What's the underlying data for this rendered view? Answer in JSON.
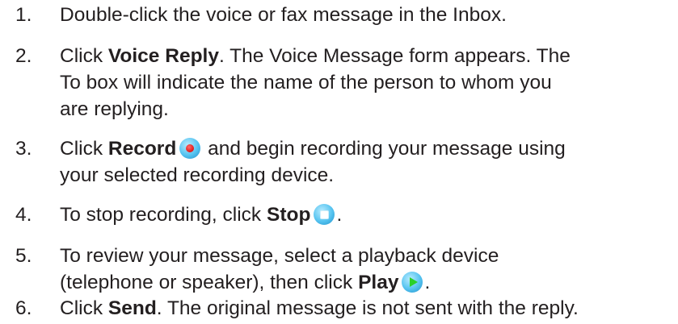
{
  "steps": [
    {
      "number": "1.",
      "line1": "Double-click the voice or fax message in the Inbox."
    },
    {
      "number": "2.",
      "pre": "Click ",
      "bold": "Voice Reply",
      "line1_post": ". The Voice Message form appears. The",
      "line2": "To box will indicate the name of the person to whom you",
      "line3": "are replying."
    },
    {
      "number": "3.",
      "pre": "Click ",
      "bold": "Record",
      "line1_post": " and begin recording your message using",
      "line2": "your selected recording device.",
      "icon": "record-icon"
    },
    {
      "number": "4.",
      "pre": "To stop recording, click ",
      "bold": "Stop",
      "post": ".",
      "icon": "stop-icon"
    },
    {
      "number": "5.",
      "line1": "To review your message, select a playback device",
      "pre2": "(telephone or speaker), then click ",
      "bold": "Play",
      "post": ".",
      "icon": "play-icon"
    },
    {
      "number": "6.",
      "pre": "Click ",
      "bold": "Send",
      "post": ". The original message is not sent with the reply."
    }
  ]
}
